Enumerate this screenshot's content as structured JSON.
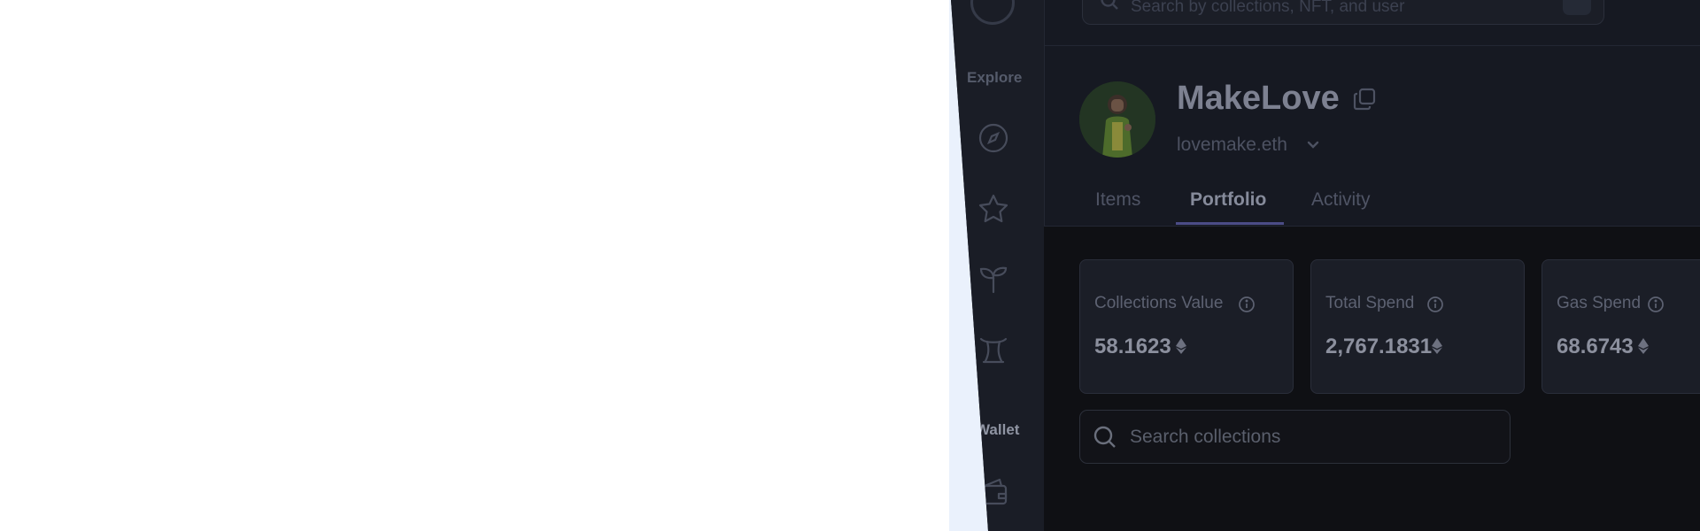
{
  "sidebar": {
    "explore_label": "Explore",
    "wallet_label": "Wallet",
    "icons": [
      "compass-icon",
      "star-icon",
      "sprout-icon",
      "trophy-icon",
      "wallet-icon"
    ]
  },
  "header": {
    "search_placeholder": "Search by collections, NFT, and user"
  },
  "profile": {
    "name": "MakeLove",
    "ens": "lovemake.eth"
  },
  "tabs": [
    {
      "label": "Items",
      "active": false
    },
    {
      "label": "Portfolio",
      "active": true
    },
    {
      "label": "Activity",
      "active": false
    }
  ],
  "stats": [
    {
      "label": "Collections Value",
      "value": "58.1623"
    },
    {
      "label": "Total Spend",
      "value": "2,767.1831"
    },
    {
      "label": "Gas Spend",
      "value": "68.6743"
    }
  ],
  "collections_search": {
    "placeholder": "Search collections"
  },
  "colors": {
    "background": "#161922",
    "accent": "#4b4c86",
    "card": "#1b1e27"
  }
}
